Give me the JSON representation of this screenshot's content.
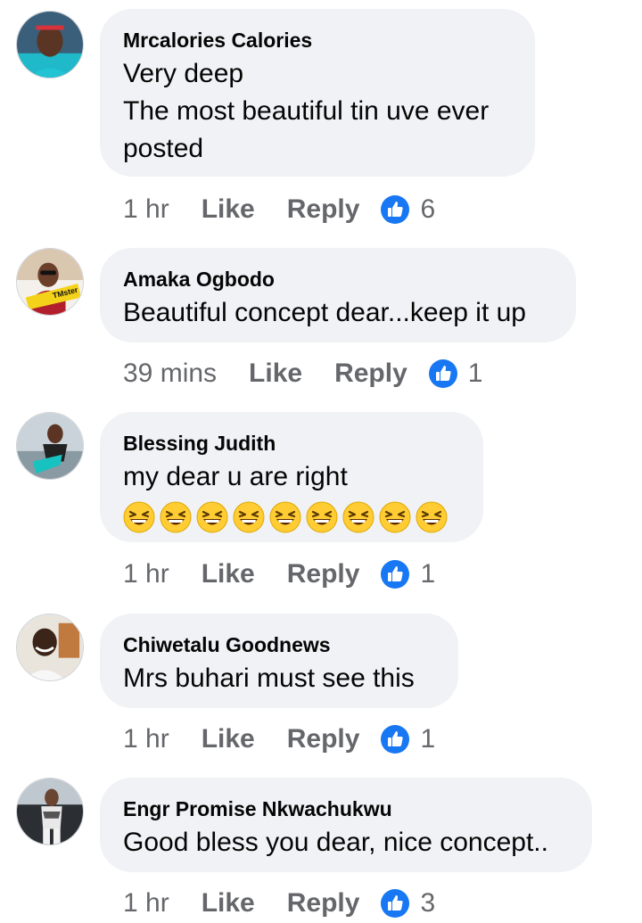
{
  "comments": [
    {
      "author": "Mrcalories Calories",
      "text_lines": [
        "Very deep",
        "The most beautiful tin uve ever",
        "posted"
      ],
      "time": "1 hr",
      "like_label": "Like",
      "reply_label": "Reply",
      "reaction_count": "6"
    },
    {
      "author": "Amaka Ogbodo",
      "text_lines": [
        "Beautiful concept dear...keep it up"
      ],
      "time": "39 mins",
      "like_label": "Like",
      "reply_label": "Reply",
      "reaction_count": "1",
      "avatar_badge": "TMster"
    },
    {
      "author": "Blessing Judith",
      "text_lines": [
        "my dear u are right"
      ],
      "emoji_count": 9,
      "emoji_name": "grinning-squinting-face",
      "time": "1 hr",
      "like_label": "Like",
      "reply_label": "Reply",
      "reaction_count": "1"
    },
    {
      "author": "Chiwetalu Goodnews",
      "text_lines": [
        "Mrs buhari must see this"
      ],
      "time": "1 hr",
      "like_label": "Like",
      "reply_label": "Reply",
      "reaction_count": "1"
    },
    {
      "author": "Engr Promise Nkwachukwu",
      "text_lines": [
        "Good bless you dear, nice concept.."
      ],
      "time": "1 hr",
      "like_label": "Like",
      "reply_label": "Reply",
      "reaction_count": "3"
    }
  ],
  "colors": {
    "bubble": "#f0f2f5",
    "meta_text": "#65676b",
    "like_reaction": "#1877f2"
  },
  "icons": {
    "reaction": "thumbs-up-like-icon"
  }
}
